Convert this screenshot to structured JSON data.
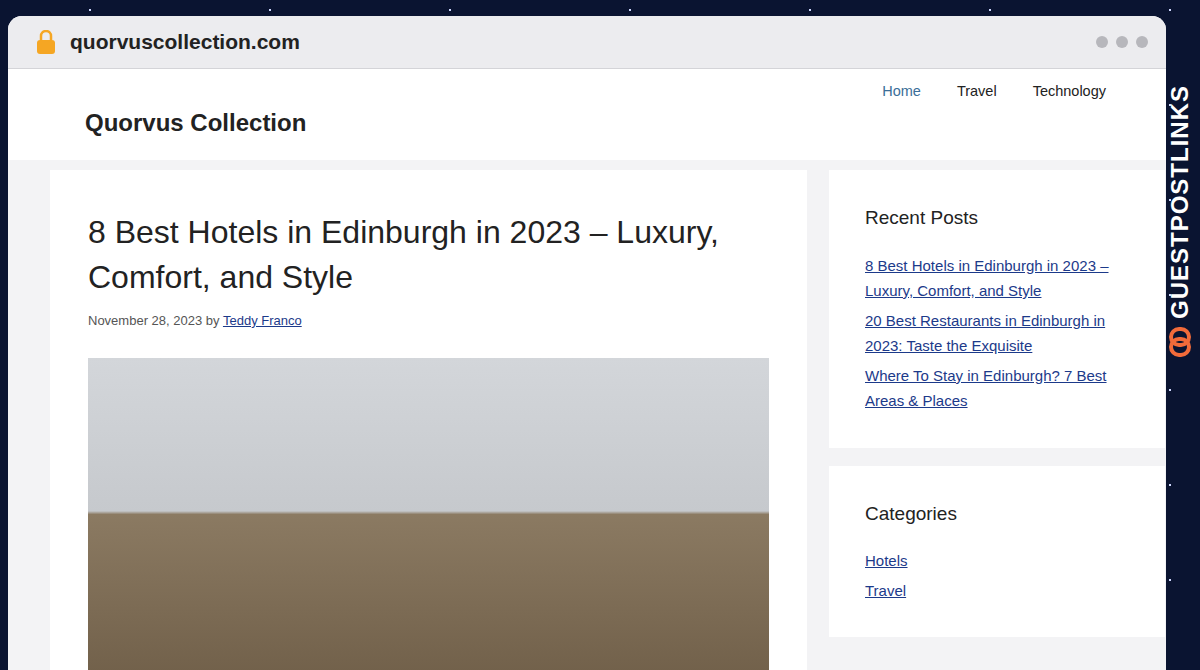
{
  "browser": {
    "address": "quorvuscollection.com"
  },
  "site": {
    "title": "Quorvus Collection",
    "nav": [
      {
        "label": "Home",
        "selected": true
      },
      {
        "label": "Travel",
        "selected": false
      },
      {
        "label": "Technology",
        "selected": false
      }
    ]
  },
  "post": {
    "title": "8 Best Hotels in Edinburgh in 2023 – Luxury, Comfort, and Style",
    "date": "November 28, 2023",
    "by": "by",
    "author": "Teddy Franco"
  },
  "sidebar": {
    "recent_title": "Recent Posts",
    "recent": [
      "8 Best Hotels in Edinburgh in 2023 – Luxury, Comfort, and Style",
      "20 Best Restaurants in Edinburgh in 2023: Taste the Exquisite",
      "Where To Stay in Edinburgh? 7 Best Areas & Places"
    ],
    "categories_title": "Categories",
    "categories": [
      "Hotels",
      "Travel"
    ]
  },
  "watermark": "GUESTPOSTLINKS"
}
